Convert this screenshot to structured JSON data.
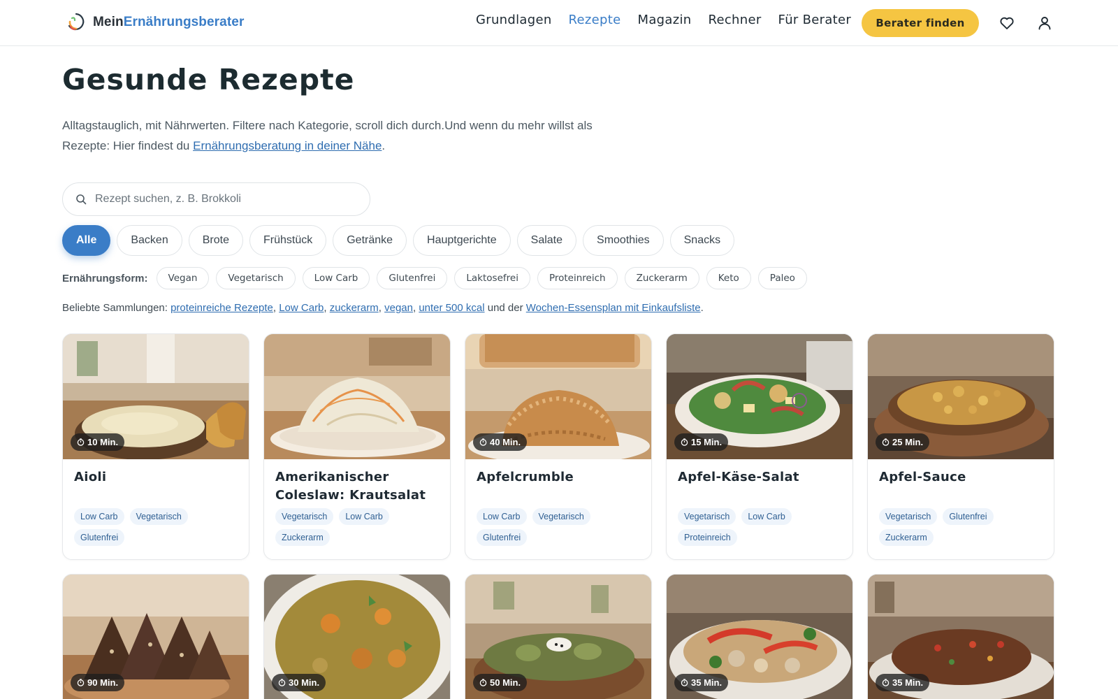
{
  "header": {
    "logo_part1": "Mein",
    "logo_part2": "Ernährungsberater",
    "nav": [
      "Grundlagen",
      "Rezepte",
      "Magazin",
      "Rechner",
      "Für Berater"
    ],
    "active_nav": "Rezepte",
    "cta_label": "Berater finden",
    "icons": [
      "heart-icon",
      "user-icon"
    ]
  },
  "page": {
    "title": "Gesunde Rezepte",
    "intro_text": "Alltagstauglich, mit Nährwerten. Filtere nach Kategorie, scroll dich durch.Und wenn du mehr willst als Rezepte: Hier findest du ",
    "intro_link": "Ernährungsberatung in deiner Nähe",
    "intro_end": "."
  },
  "search": {
    "placeholder": "Rezept suchen, z. B. Brokkoli",
    "value": ""
  },
  "categories": [
    "Alle",
    "Backen",
    "Brote",
    "Frühstück",
    "Getränke",
    "Hauptgerichte",
    "Salate",
    "Smoothies",
    "Snacks"
  ],
  "active_category": "Alle",
  "diet": {
    "label": "Ernährungsform:",
    "options": [
      "Vegan",
      "Vegetarisch",
      "Low Carb",
      "Glutenfrei",
      "Laktosefrei",
      "Proteinreich",
      "Zuckerarm",
      "Keto",
      "Paleo"
    ]
  },
  "collections": {
    "prefix": "Beliebte Sammlungen: ",
    "links": [
      "proteinreiche Rezepte",
      "Low Carb",
      "zuckerarm",
      "vegan",
      "unter 500 kcal"
    ],
    "middle": " und der ",
    "plan_link": "Wochen-Essensplan mit Einkaufsliste",
    "suffix": "."
  },
  "recipes": [
    {
      "title": "Aioli",
      "time": "10 Min.",
      "tags": [
        "Low Carb",
        "Vegetarisch",
        "Glutenfrei"
      ],
      "image": "aioli-bowl"
    },
    {
      "title": "Amerikanischer Coleslaw: Krautsalat",
      "time": "",
      "tags": [
        "Vegetarisch",
        "Low Carb",
        "Zuckerarm"
      ],
      "image": "coleslaw-plate"
    },
    {
      "title": "Apfelcrumble",
      "time": "40 Min.",
      "tags": [
        "Low Carb",
        "Vegetarisch",
        "Glutenfrei"
      ],
      "image": "apple-crumble"
    },
    {
      "title": "Apfel-Käse-Salat",
      "time": "15 Min.",
      "tags": [
        "Vegetarisch",
        "Low Carb",
        "Proteinreich"
      ],
      "image": "apple-cheese-salad"
    },
    {
      "title": "Apfel-Sauce",
      "time": "25 Min.",
      "tags": [
        "Vegetarisch",
        "Glutenfrei",
        "Zuckerarm"
      ],
      "image": "apple-sauce-bowl"
    },
    {
      "title": "",
      "time": "90 Min.",
      "tags": [],
      "image": "bread-loaf"
    },
    {
      "title": "",
      "time": "30 Min.",
      "tags": [],
      "image": "curry-plate"
    },
    {
      "title": "",
      "time": "50 Min.",
      "tags": [],
      "image": "artichoke-bowl"
    },
    {
      "title": "",
      "time": "35 Min.",
      "tags": [],
      "image": "stir-fry-bowl"
    },
    {
      "title": "",
      "time": "35 Min.",
      "tags": [],
      "image": "mince-plate"
    }
  ],
  "colors": {
    "accent": "#3a7dc7",
    "cta": "#f5c542",
    "tag_bg": "#eef4fb"
  }
}
